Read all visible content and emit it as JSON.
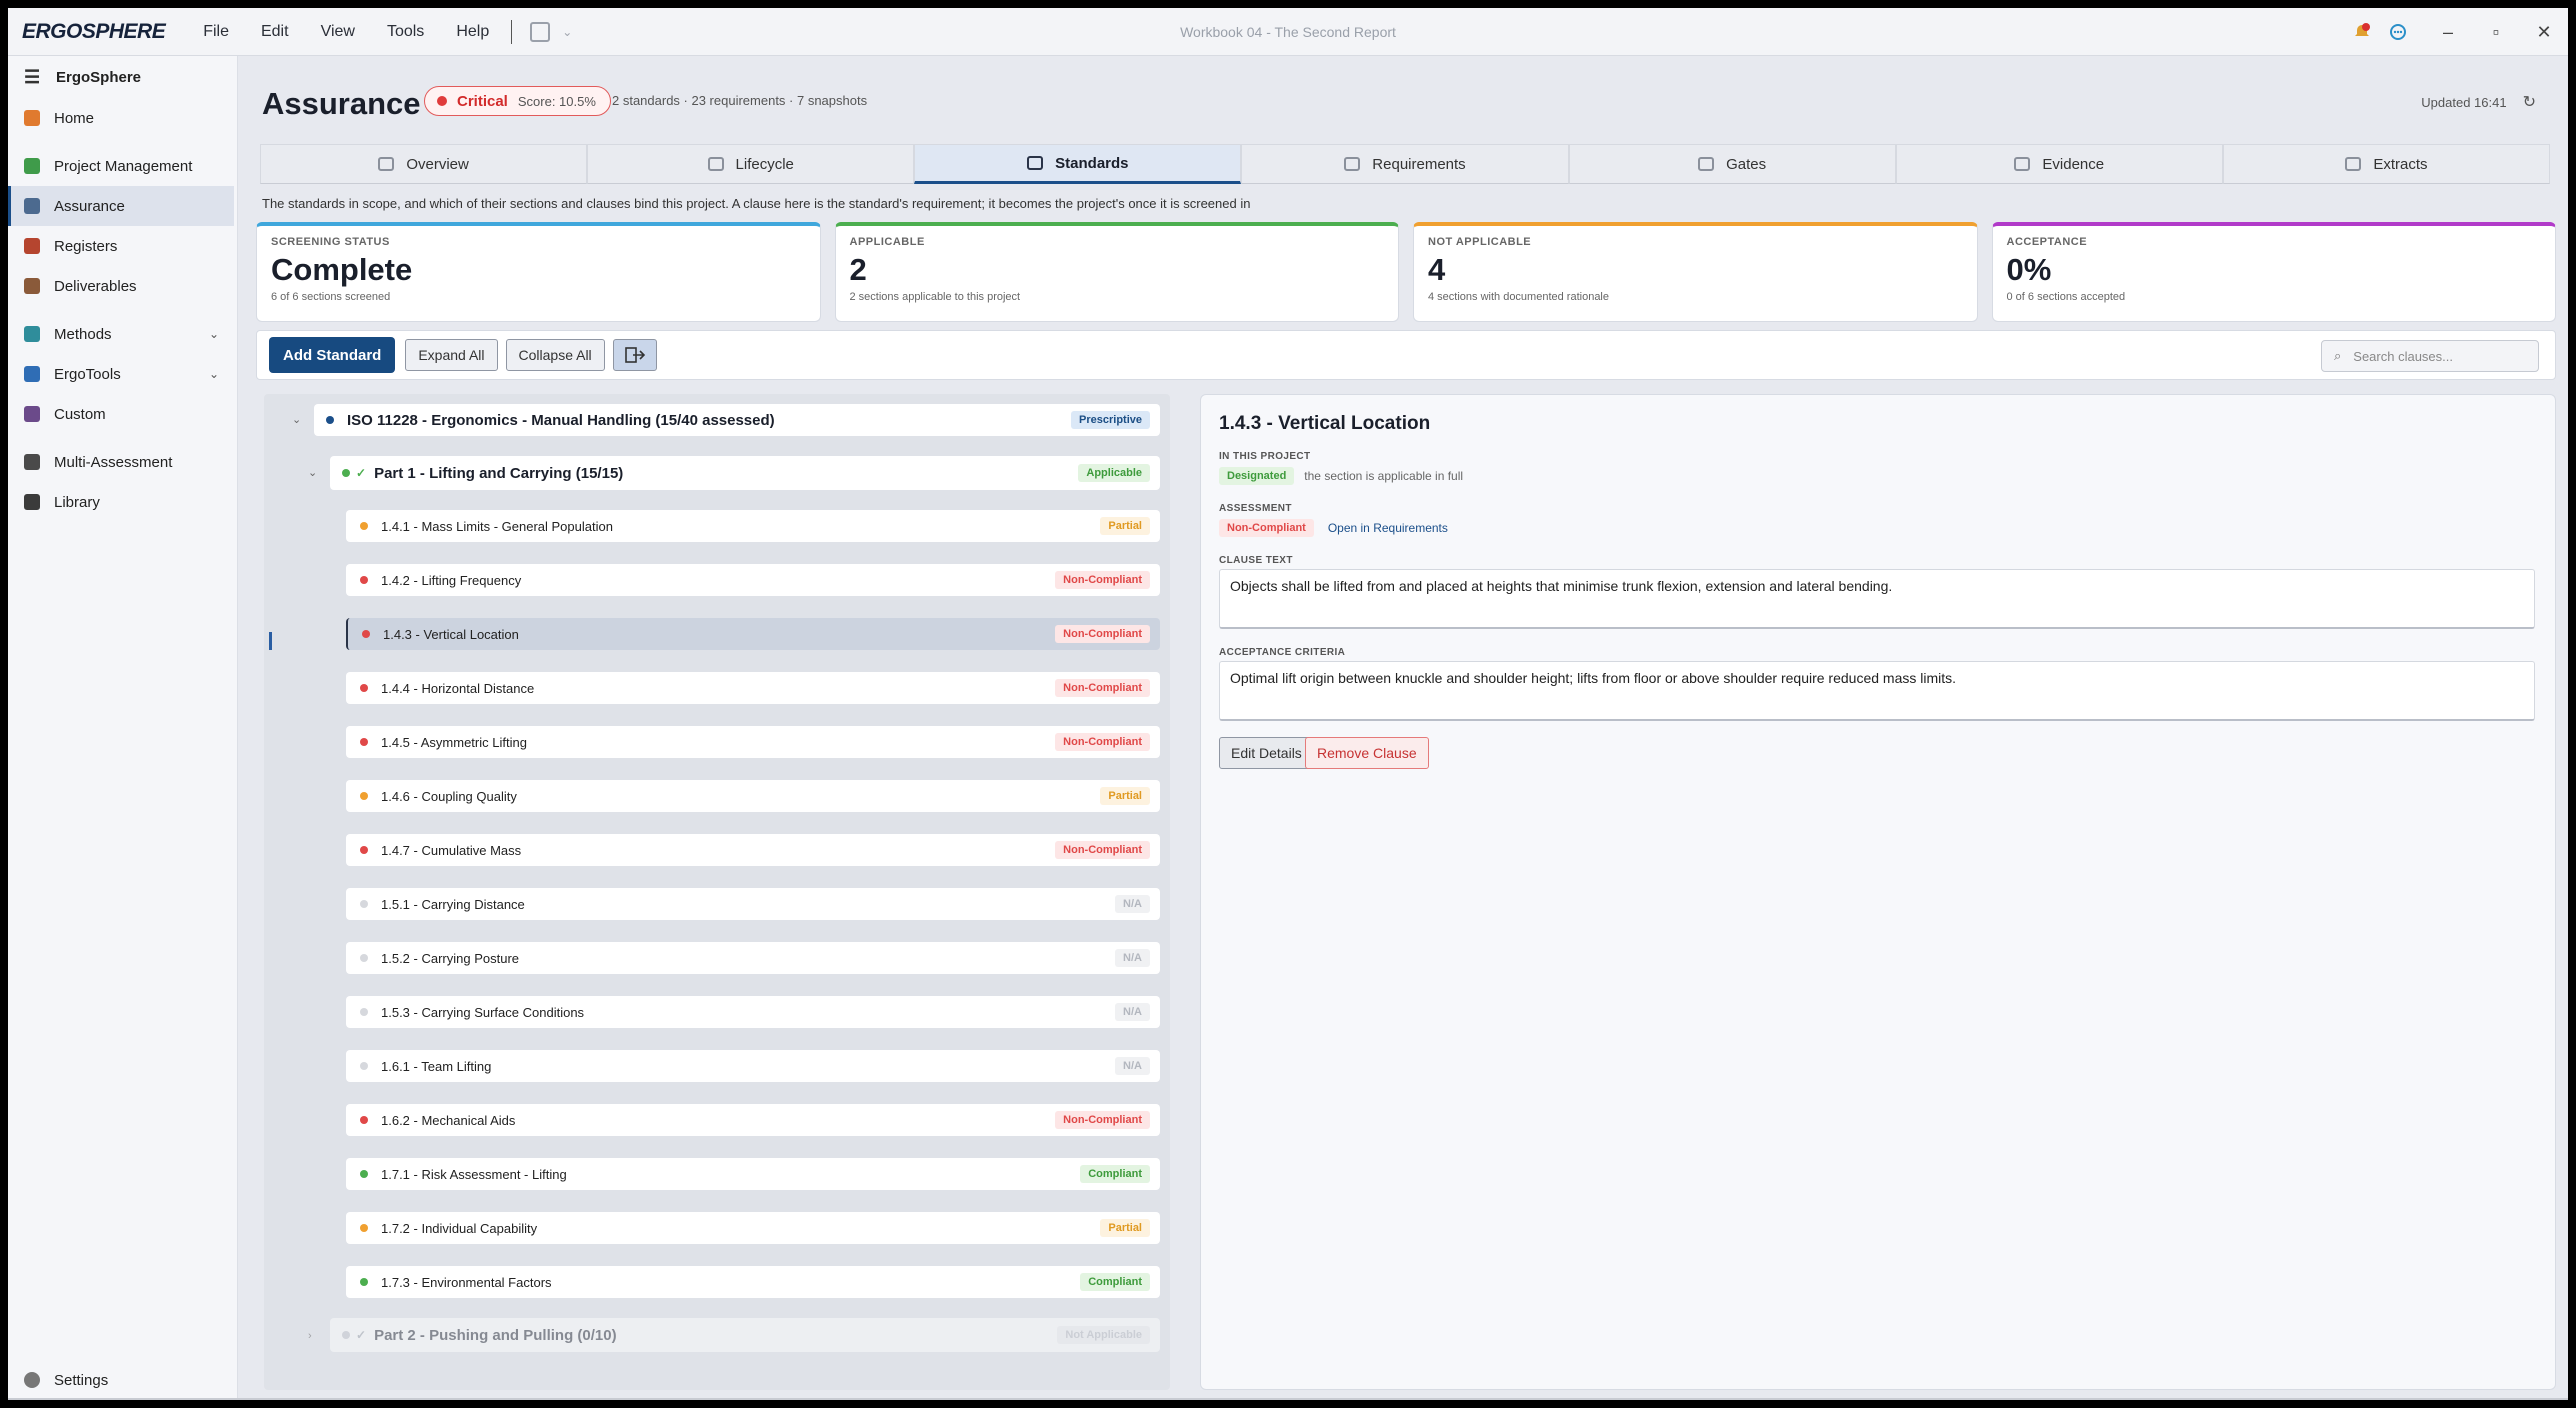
{
  "app": {
    "logo": "ERGOSPHERE",
    "window_title": "Workbook 04 - The Second Report",
    "menu": [
      "File",
      "Edit",
      "View",
      "Tools",
      "Help"
    ]
  },
  "sidebar": {
    "header": "ErgoSphere",
    "items": [
      {
        "label": "Home",
        "icon": "home-icon",
        "color": "#e07a2f"
      },
      {
        "label": "Project Management",
        "icon": "triangle-icon",
        "color": "#3f9b4a"
      },
      {
        "label": "Assurance",
        "icon": "shield-icon",
        "color": "#4c6a8f"
      },
      {
        "label": "Registers",
        "icon": "book-icon",
        "color": "#b5452f"
      },
      {
        "label": "Deliverables",
        "icon": "package-icon",
        "color": "#8a5a3a"
      },
      {
        "label": "Methods",
        "icon": "methods-icon",
        "color": "#2f8d9b"
      },
      {
        "label": "ErgoTools",
        "icon": "tools-icon",
        "color": "#2f6db5"
      },
      {
        "label": "Custom",
        "icon": "custom-icon",
        "color": "#6b4a8a"
      },
      {
        "label": "Multi-Assessment",
        "icon": "multi-icon",
        "color": "#4a4a4a"
      },
      {
        "label": "Library",
        "icon": "library-icon",
        "color": "#3b3b3b"
      }
    ],
    "settings": "Settings"
  },
  "header": {
    "title": "Assurance",
    "status_label": "Critical",
    "score": "Score: 10.5%",
    "summary": "2 standards · 23 requirements · 7 snapshots",
    "updated": "Updated 16:41"
  },
  "tabs": [
    "Overview",
    "Lifecycle",
    "Standards",
    "Requirements",
    "Gates",
    "Evidence",
    "Extracts"
  ],
  "description": "The standards in scope, and which of their sections and clauses bind this project. A clause here is the standard's requirement; it becomes the project's once it is screened in",
  "cards": [
    {
      "label": "SCREENING STATUS",
      "value": "Complete",
      "sub": "6 of 6 sections screened",
      "color": "#3fa7dc"
    },
    {
      "label": "APPLICABLE",
      "value": "2",
      "sub": "2 sections applicable to this project",
      "color": "#4cae4f"
    },
    {
      "label": "NOT APPLICABLE",
      "value": "4",
      "sub": "4 sections with documented rationale",
      "color": "#f0a030"
    },
    {
      "label": "ACCEPTANCE",
      "value": "0%",
      "sub": "0 of 6 sections accepted",
      "color": "#b13ac9"
    }
  ],
  "toolbar": {
    "add": "Add Standard",
    "expand": "Expand All",
    "collapse": "Collapse All",
    "search_placeholder": "Search clauses..."
  },
  "tree": {
    "standard": {
      "label": "ISO 11228 - Ergonomics - Manual Handling  (15/40 assessed)",
      "badge": "Prescriptive"
    },
    "part1": {
      "label": "Part 1 - Lifting and Carrying  (15/15)",
      "badge": "Applicable"
    },
    "clauses": [
      {
        "label": "1.4.1 - Mass Limits - General Population",
        "status": "Partial"
      },
      {
        "label": "1.4.2 - Lifting Frequency",
        "status": "Non-Compliant"
      },
      {
        "label": "1.4.3 - Vertical Location",
        "status": "Non-Compliant",
        "selected": true
      },
      {
        "label": "1.4.4 - Horizontal Distance",
        "status": "Non-Compliant"
      },
      {
        "label": "1.4.5 - Asymmetric Lifting",
        "status": "Non-Compliant"
      },
      {
        "label": "1.4.6 - Coupling Quality",
        "status": "Partial"
      },
      {
        "label": "1.4.7 - Cumulative Mass",
        "status": "Non-Compliant"
      },
      {
        "label": "1.5.1 - Carrying Distance",
        "status": "N/A"
      },
      {
        "label": "1.5.2 - Carrying Posture",
        "status": "N/A"
      },
      {
        "label": "1.5.3 - Carrying Surface Conditions",
        "status": "N/A"
      },
      {
        "label": "1.6.1 - Team Lifting",
        "status": "N/A"
      },
      {
        "label": "1.6.2 - Mechanical Aids",
        "status": "Non-Compliant"
      },
      {
        "label": "1.7.1 - Risk Assessment - Lifting",
        "status": "Compliant"
      },
      {
        "label": "1.7.2 - Individual Capability",
        "status": "Partial"
      },
      {
        "label": "1.7.3 - Environmental Factors",
        "status": "Compliant"
      }
    ],
    "part2": {
      "label": "Part 2 - Pushing and Pulling  (0/10)",
      "badge": "Not Applicable"
    }
  },
  "detail": {
    "title": "1.4.3 - Vertical Location",
    "in_project_label": "IN THIS PROJECT",
    "designated": "Designated",
    "designated_note": "the section is applicable in full",
    "assessment_label": "ASSESSMENT",
    "assessment": "Non-Compliant",
    "open_link": "Open in Requirements",
    "clause_label": "CLAUSE TEXT",
    "clause_text": "Objects shall be lifted from and placed at heights that minimise trunk flexion, extension and lateral bending.",
    "criteria_label": "ACCEPTANCE CRITERIA",
    "criteria_text": "Optimal lift origin between knuckle and shoulder height; lifts from floor or above shoulder require reduced mass limits.",
    "edit": "Edit Details",
    "remove": "Remove Clause"
  }
}
